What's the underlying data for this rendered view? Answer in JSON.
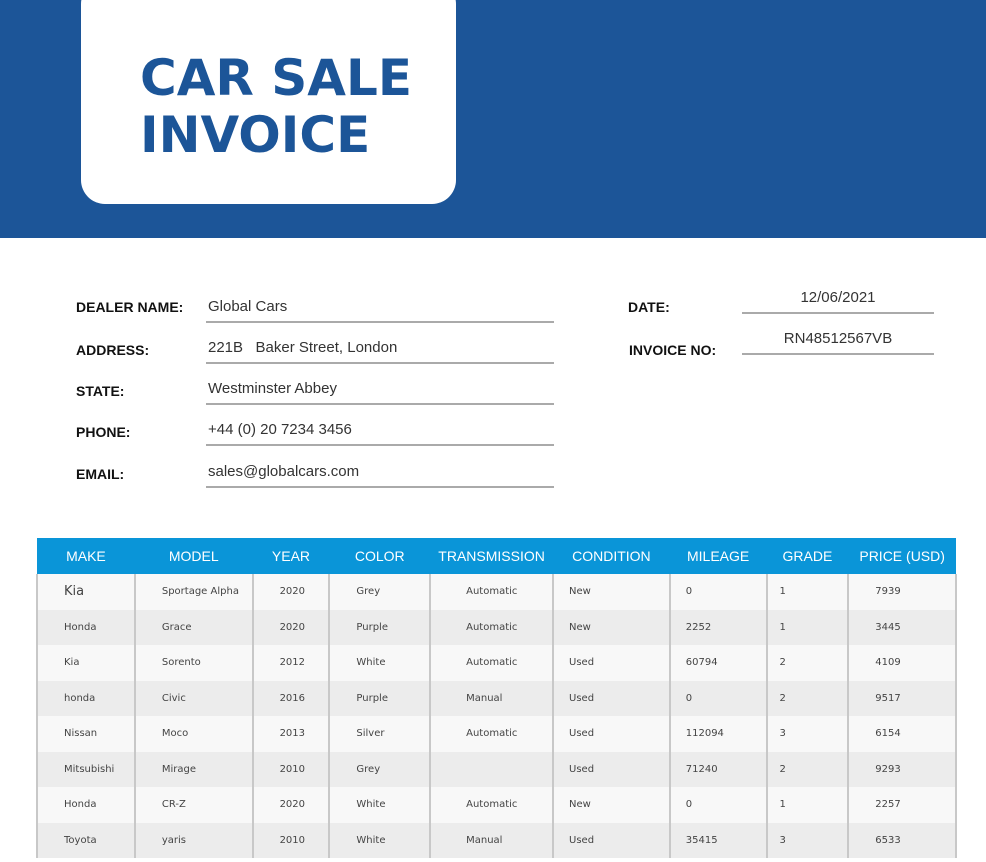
{
  "title_line1": "CAR SALE",
  "title_line2": "INVOICE",
  "dealer": {
    "name_label": "DEALER NAME:",
    "name": "Global Cars",
    "address_label": "ADDRESS:",
    "address": "221B   Baker Street, London",
    "state_label": "STATE:",
    "state": "Westminster Abbey",
    "phone_label": "PHONE:",
    "phone": "+44 (0) 20 7234 3456",
    "email_label": "EMAIL:",
    "email": "sales@globalcars.com"
  },
  "invoice": {
    "date_label": "DATE:",
    "date": "12/06/2021",
    "number_label": "INVOICE NO:",
    "number": "RN48512567VB"
  },
  "table": {
    "headers": [
      "MAKE",
      "MODEL",
      "YEAR",
      "COLOR",
      "TRANSMISSION",
      "CONDITION",
      "MILEAGE",
      "GRADE",
      "PRICE (USD)"
    ],
    "rows": [
      [
        "Kia",
        "Sportage Alpha",
        "2020",
        "Grey",
        "Automatic",
        "New",
        "0",
        "1",
        "7939"
      ],
      [
        "Honda",
        "Grace",
        "2020",
        "Purple",
        "Automatic",
        "New",
        "2252",
        "1",
        "3445"
      ],
      [
        "Kia",
        "Sorento",
        "2012",
        "White",
        "Automatic",
        "Used",
        "60794",
        "2",
        "4109"
      ],
      [
        "honda",
        "Civic",
        "2016",
        "Purple",
        "Manual",
        "Used",
        "0",
        "2",
        "9517"
      ],
      [
        "Nissan",
        "Moco",
        "2013",
        "Silver",
        "Automatic",
        "Used",
        "112094",
        "3",
        "6154"
      ],
      [
        "Mitsubishi",
        "Mirage",
        "2010",
        "Grey",
        "",
        "Used",
        "71240",
        "2",
        "9293"
      ],
      [
        "Honda",
        "CR-Z",
        "2020",
        "White",
        "Automatic",
        "New",
        "0",
        "1",
        "2257"
      ],
      [
        "Toyota",
        "yaris",
        "2010",
        "White",
        "Manual",
        "Used",
        "35415",
        "3",
        "6533"
      ]
    ]
  }
}
